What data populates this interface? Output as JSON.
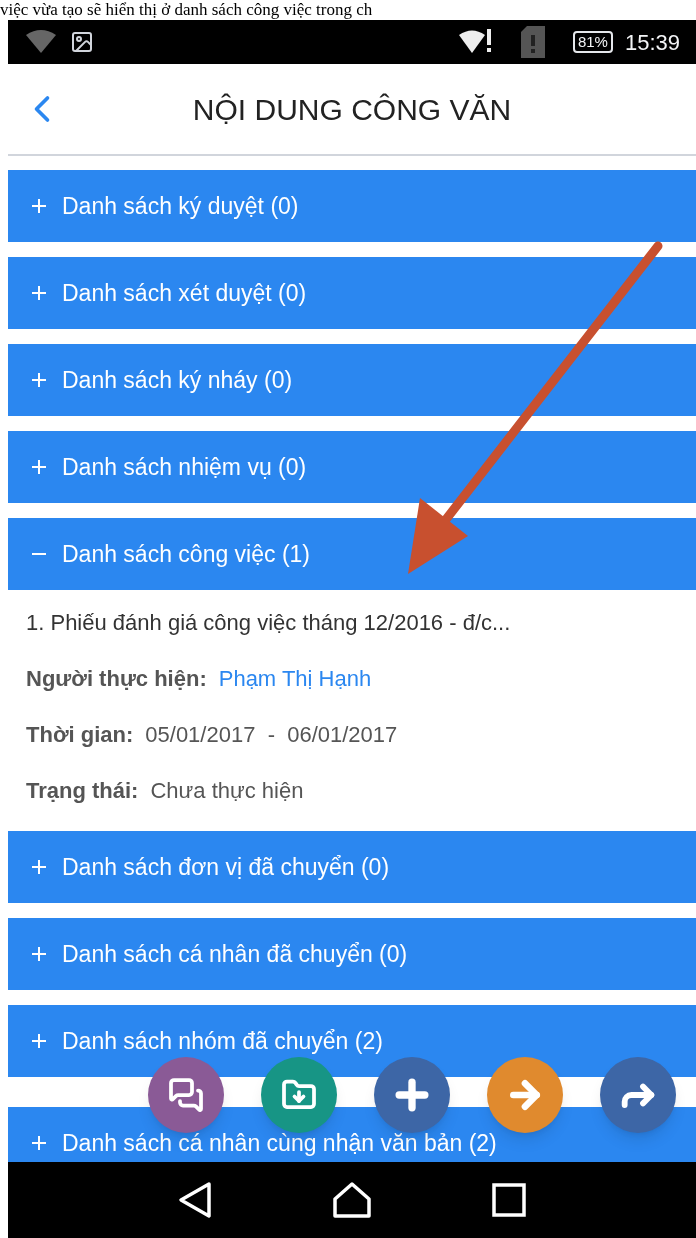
{
  "caption": "việc vừa tạo sẽ hiển thị ở danh sách công việc trong ch",
  "status_bar": {
    "battery": "81%",
    "time": "15:39"
  },
  "header": {
    "title": "NỘI DUNG CÔNG VĂN"
  },
  "sections": [
    {
      "label": "Danh sách ký duyệt (0)",
      "expanded": false
    },
    {
      "label": "Danh sách xét duyệt (0)",
      "expanded": false
    },
    {
      "label": "Danh sách ký nháy (0)",
      "expanded": false
    },
    {
      "label": "Danh sách nhiệm vụ (0)",
      "expanded": false
    },
    {
      "label": "Danh sách công việc (1)",
      "expanded": true,
      "items": [
        {
          "title": "1. Phiếu đánh giá công việc tháng 12/2016 - đ/c...",
          "fields": [
            {
              "label": "Người thực hiện:",
              "value": "Phạm Thị Hạnh",
              "kind": "link"
            },
            {
              "label": "Thời gian:",
              "value": "05/01/2017  -  06/01/2017",
              "kind": "text"
            },
            {
              "label": "Trạng thái:",
              "value": "Chưa thực hiện",
              "kind": "text"
            }
          ]
        }
      ]
    },
    {
      "label": "Danh sách đơn vị đã chuyển (0)",
      "expanded": false
    },
    {
      "label": "Danh sách cá nhân đã chuyển (0)",
      "expanded": false
    },
    {
      "label": "Danh sách nhóm đã chuyển (2)",
      "expanded": false
    },
    {
      "label": "Danh sách cá nhân cùng nhận văn bản (2)",
      "expanded": false
    }
  ],
  "fab_buttons": [
    {
      "kind": "chat",
      "color": "#8a5a96"
    },
    {
      "kind": "folder",
      "color": "#179585"
    },
    {
      "kind": "add",
      "color": "#3d66a6"
    },
    {
      "kind": "next",
      "color": "#e08a2e"
    },
    {
      "kind": "share",
      "color": "#3d66a6"
    }
  ]
}
